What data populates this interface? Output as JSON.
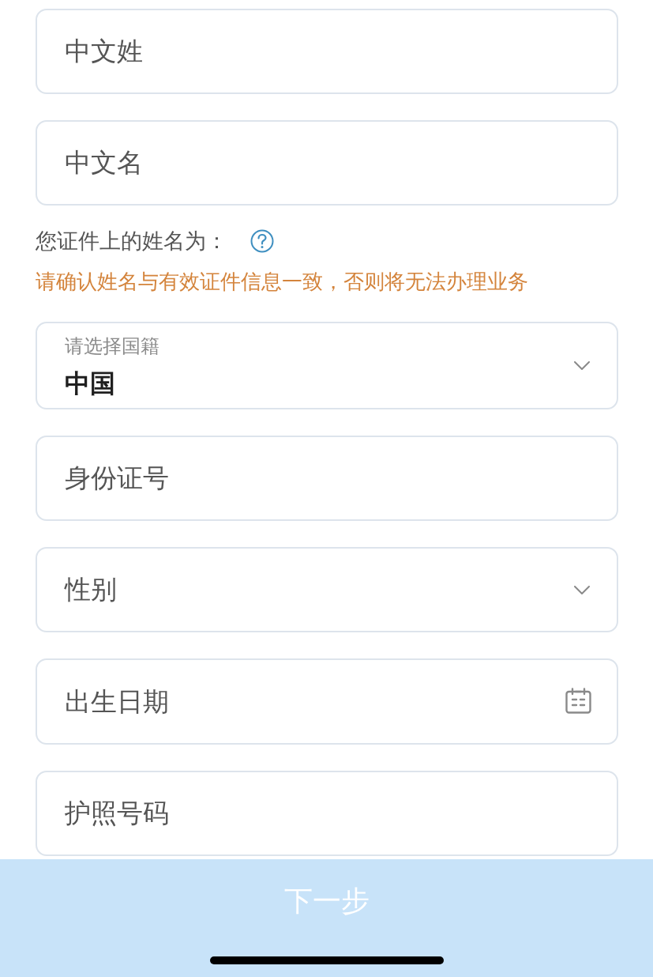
{
  "name_fields": [
    {
      "kind": "text",
      "placeholder": "中文姓"
    },
    {
      "kind": "text",
      "placeholder": "中文名"
    }
  ],
  "name_on_id": {
    "label": "您证件上的姓名为：",
    "warning": "请确认姓名与有效证件信息一致，否则将无法办理业务"
  },
  "fields": [
    {
      "kind": "select",
      "label": "请选择国籍",
      "value": "中国"
    },
    {
      "kind": "text",
      "placeholder": "身份证号"
    },
    {
      "kind": "select",
      "placeholder": "性别"
    },
    {
      "kind": "date",
      "placeholder": "出生日期"
    },
    {
      "kind": "text",
      "placeholder": "护照号码"
    }
  ],
  "next_button": {
    "label": "下一步",
    "disabled": true
  }
}
